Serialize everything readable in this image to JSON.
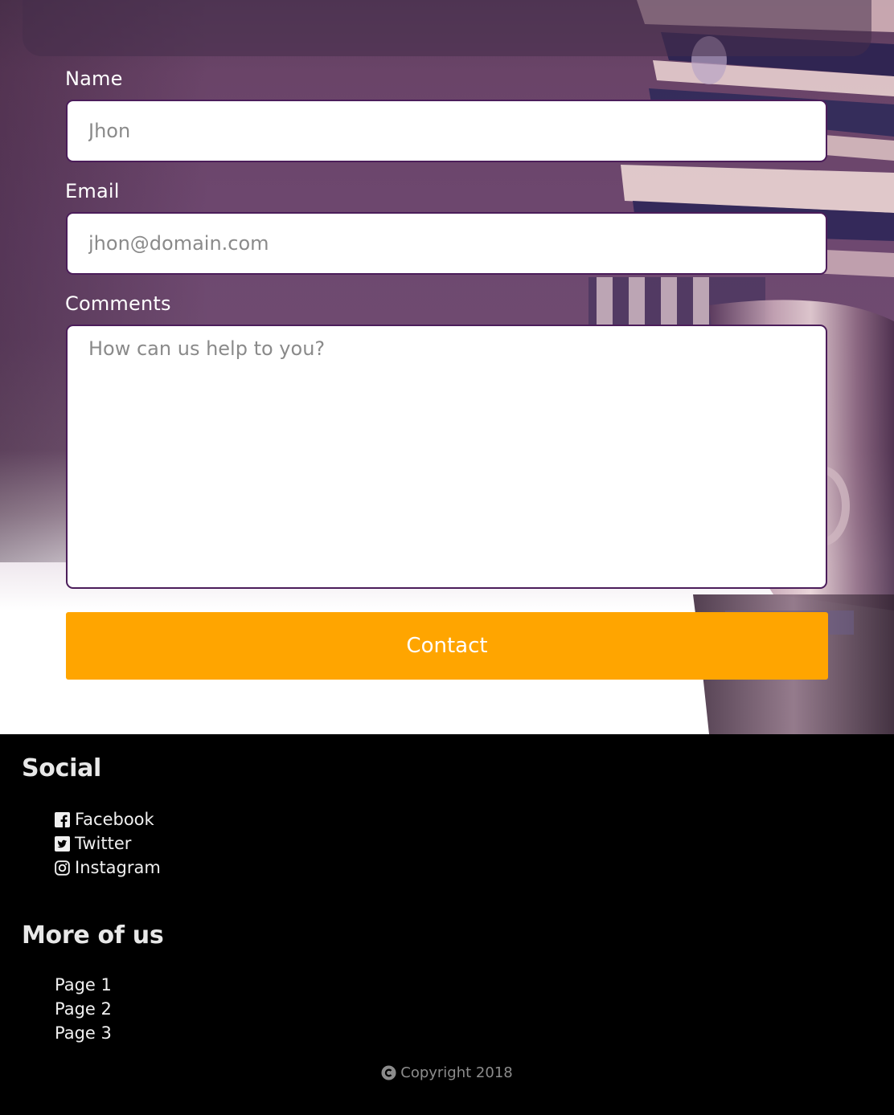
{
  "form": {
    "name_label": "Name",
    "name_placeholder": "Jhon",
    "name_value": "",
    "email_label": "Email",
    "email_placeholder": "jhon@domain.com",
    "email_value": "",
    "comments_label": "Comments",
    "comments_placeholder": "How can us help to you?",
    "comments_value": "",
    "submit_label": "Contact"
  },
  "footer": {
    "social_heading": "Social",
    "social_links": [
      {
        "label": "Facebook",
        "icon": "facebook-square-icon"
      },
      {
        "label": "Twitter",
        "icon": "twitter-square-icon"
      },
      {
        "label": "Instagram",
        "icon": "instagram-icon"
      }
    ],
    "more_heading": "More of us",
    "pages": [
      {
        "label": "Page 1"
      },
      {
        "label": "Page 2"
      },
      {
        "label": "Page 3"
      }
    ],
    "copyright": "Copyright 2018",
    "copyright_icon": "copyright-icon"
  },
  "colors": {
    "accent": "#ffa500",
    "input_border": "#4b1d5a",
    "footer_bg": "#000000",
    "hero_tint": "#6e4870"
  }
}
